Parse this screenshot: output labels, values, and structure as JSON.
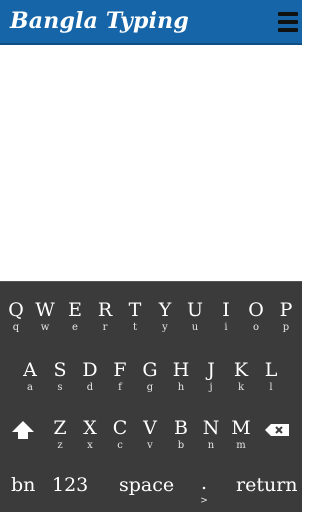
{
  "header": {
    "title": "Bangla Typing",
    "menu_icon": "hamburger-menu-icon",
    "background": "#1565a8"
  },
  "text_area": {
    "value": ""
  },
  "keyboard": {
    "background": "#3b3b3b",
    "row1": [
      {
        "up": "Q",
        "low": "q"
      },
      {
        "up": "W",
        "low": "w"
      },
      {
        "up": "E",
        "low": "e"
      },
      {
        "up": "R",
        "low": "r"
      },
      {
        "up": "T",
        "low": "t"
      },
      {
        "up": "Y",
        "low": "y"
      },
      {
        "up": "U",
        "low": "u"
      },
      {
        "up": "I",
        "low": "i"
      },
      {
        "up": "O",
        "low": "o"
      },
      {
        "up": "P",
        "low": "p"
      }
    ],
    "row2": [
      {
        "up": "A",
        "low": "a"
      },
      {
        "up": "S",
        "low": "s"
      },
      {
        "up": "D",
        "low": "d"
      },
      {
        "up": "F",
        "low": "f"
      },
      {
        "up": "G",
        "low": "g"
      },
      {
        "up": "H",
        "low": "h"
      },
      {
        "up": "J",
        "low": "j"
      },
      {
        "up": "K",
        "low": "k"
      },
      {
        "up": "L",
        "low": "l"
      }
    ],
    "row3": [
      {
        "up": "Z",
        "low": "z"
      },
      {
        "up": "X",
        "low": "x"
      },
      {
        "up": "C",
        "low": "c"
      },
      {
        "up": "V",
        "low": "v"
      },
      {
        "up": "B",
        "low": "b"
      },
      {
        "up": "N",
        "low": "n"
      },
      {
        "up": "M",
        "low": "m"
      }
    ],
    "shift_icon": "shift-arrow-icon",
    "backspace_icon": "backspace-icon",
    "bottom": {
      "lang": "bn",
      "numbers": "123",
      "space": "space",
      "period": ".",
      "period_alt": ">",
      "return": "return"
    }
  }
}
